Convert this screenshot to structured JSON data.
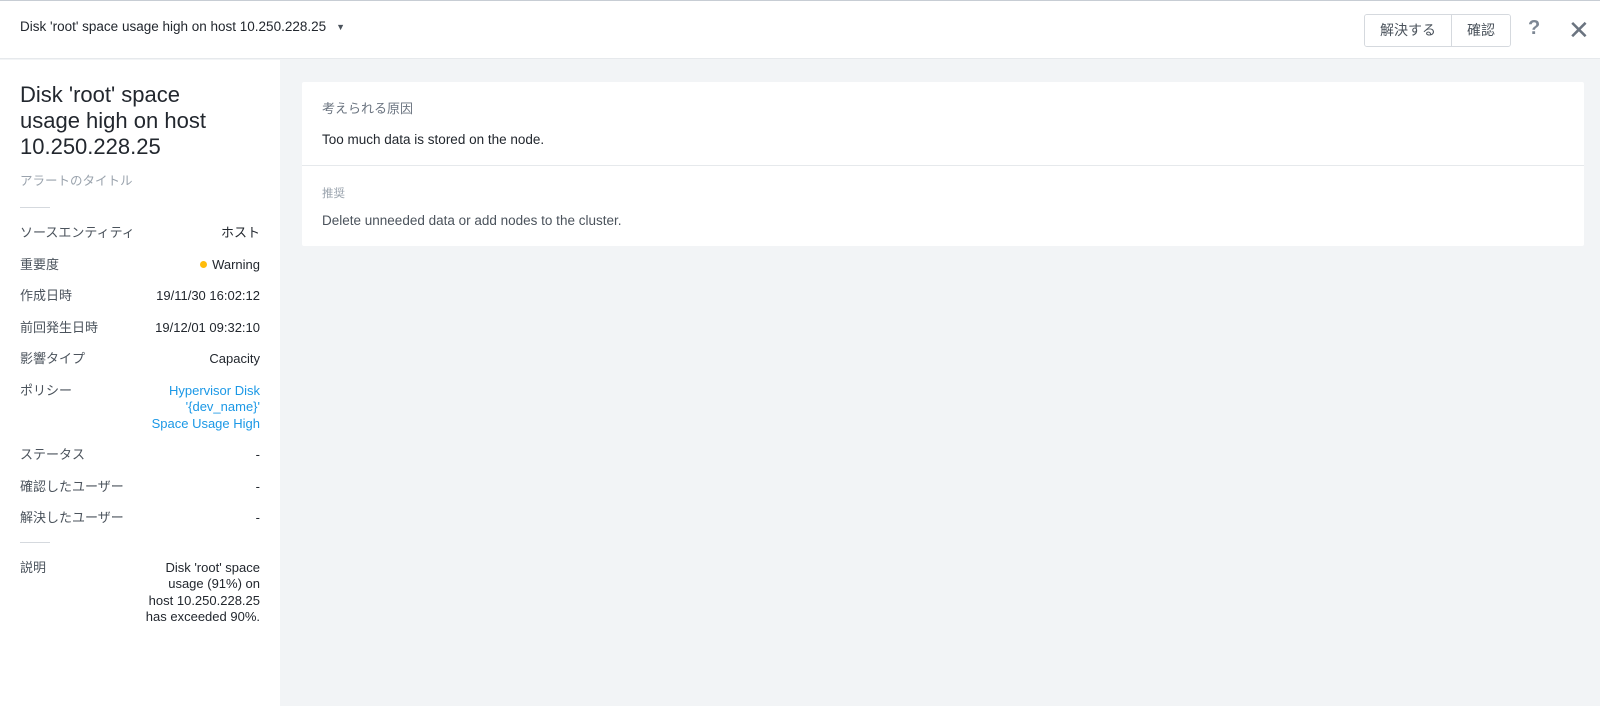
{
  "header": {
    "title": "Disk 'root' space usage high on host 10.250.228.25",
    "chevron_icon": "chevron-down-icon",
    "resolve_label": "解決する",
    "acknowledge_label": "確認",
    "help_label": "?",
    "close_label": "✕"
  },
  "sidebar": {
    "alert_title": "Disk 'root' space usage high on host 10.250.228.25",
    "alert_title_label": "アラートのタイトル",
    "properties": [
      {
        "label": "ソースエンティティ",
        "value": "ホスト"
      },
      {
        "label": "重要度",
        "value": "Warning",
        "color": "#ffbc0b"
      },
      {
        "label": "作成日時",
        "value": "19/11/30 16:02:12"
      },
      {
        "label": "前回発生日時",
        "value": "19/12/01 09:32:10"
      },
      {
        "label": "影響タイプ",
        "value": "Capacity"
      },
      {
        "label": "ポリシー",
        "value": "Hypervisor Disk '{dev_name}' Space Usage High",
        "color": "#1b98e6"
      },
      {
        "label": "ステータス",
        "value": "-"
      },
      {
        "label": "確認したユーザー",
        "value": "-"
      },
      {
        "label": "解決したユーザー",
        "value": "-"
      }
    ],
    "description": {
      "label": "説明",
      "value": "Disk 'root' space usage (91%) on host 10.250.228.25 has exceeded 90%."
    }
  },
  "main": {
    "cause": {
      "label": "考えられる原因",
      "text": "Too much data is stored on the node."
    },
    "recommendation": {
      "label": "推奨",
      "text": "Delete unneeded data or add nodes to the cluster."
    }
  }
}
